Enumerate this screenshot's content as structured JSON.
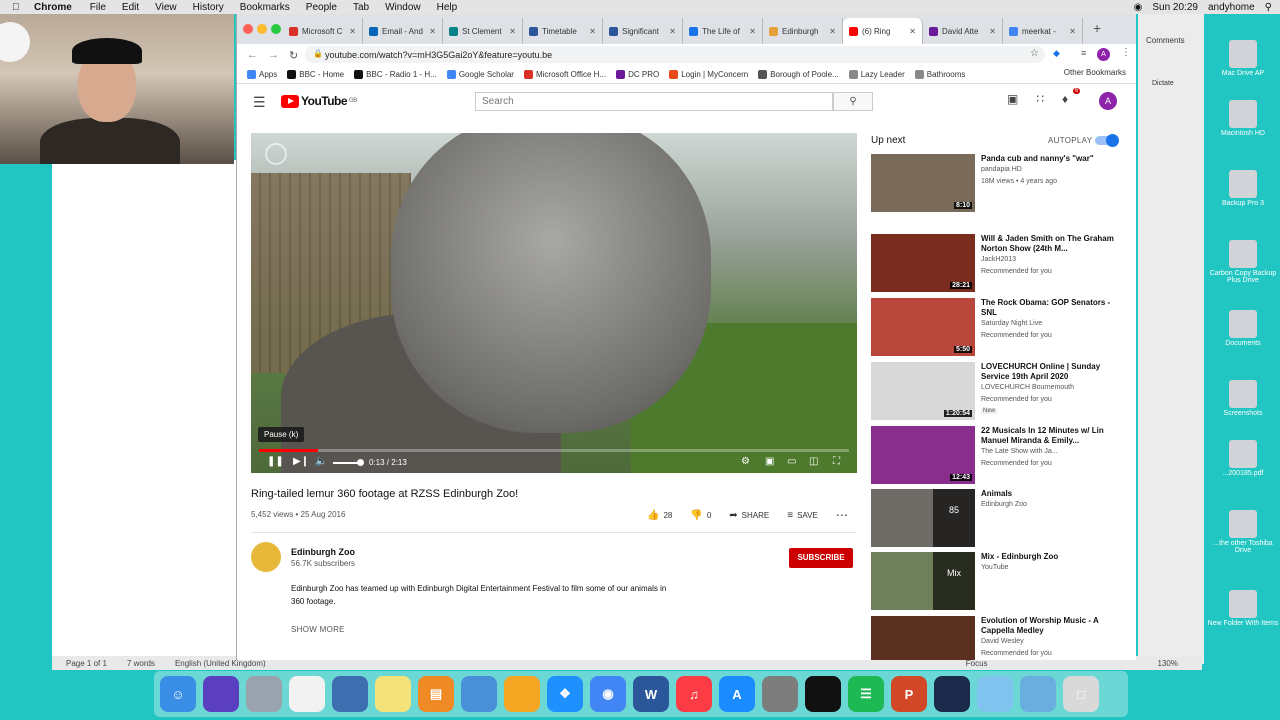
{
  "menubar": {
    "app": "Chrome",
    "items": [
      "File",
      "Edit",
      "View",
      "History",
      "Bookmarks",
      "People",
      "Tab",
      "Window",
      "Help"
    ],
    "clock": "Sun 20:29",
    "user": "andyhome"
  },
  "word": {
    "status": [
      "Page 1 of 1",
      "7 words",
      "English (United Kingdom)"
    ],
    "zoom": "130%",
    "comments": "Comments",
    "dictate": "Dictate",
    "focus": "Focus"
  },
  "tabs": [
    {
      "label": "Microsoft C",
      "color": "#d93025"
    },
    {
      "label": "Email - And",
      "color": "#0364b8"
    },
    {
      "label": "St Clement",
      "color": "#038387"
    },
    {
      "label": "Timetable",
      "color": "#2b579a"
    },
    {
      "label": "Significant",
      "color": "#2b579a"
    },
    {
      "label": "The Life of",
      "color": "#1a73e8"
    },
    {
      "label": "Edinburgh",
      "color": "#e6a13a"
    },
    {
      "label": "(6) Ring",
      "color": "#ff0000",
      "active": true
    },
    {
      "label": "David Atte",
      "color": "#6a1b9a"
    },
    {
      "label": "meerkat -",
      "color": "#4285f4"
    }
  ],
  "address": {
    "url": "youtube.com/watch?v=mH3G5Gai2oY&feature=youtu.be"
  },
  "bookmarks": [
    {
      "label": "Apps",
      "color": "#4285f4"
    },
    {
      "label": "BBC - Home",
      "color": "#111"
    },
    {
      "label": "BBC - Radio 1 - H...",
      "color": "#111"
    },
    {
      "label": "Google Scholar",
      "color": "#4285f4"
    },
    {
      "label": "Microsoft Office H...",
      "color": "#d93025"
    },
    {
      "label": "DC PRO",
      "color": "#6a1b9a"
    },
    {
      "label": "Login | MyConcern",
      "color": "#e64a19"
    },
    {
      "label": "Borough of Poole...",
      "color": "#555"
    },
    {
      "label": "Lazy Leader",
      "color": "#888"
    },
    {
      "label": "Bathrooms",
      "color": "#888"
    }
  ],
  "other_bookmarks": "Other Bookmarks",
  "yt": {
    "logo": "YouTube",
    "region": "GB",
    "search_placeholder": "Search",
    "notif_count": "6",
    "avatar": "A",
    "tooltip": "Pause (k)",
    "time": "0:13 / 2:13",
    "progress": 0.1,
    "title": "Ring-tailed lemur 360 footage at RZSS Edinburgh Zoo!",
    "meta": "5,452 views • 25 Aug 2016",
    "likes": "28",
    "dislikes": "0",
    "share": "SHARE",
    "save": "SAVE",
    "channel": "Edinburgh Zoo",
    "subs": "56.7K subscribers",
    "subscribe": "SUBSCRIBE",
    "description": "Edinburgh Zoo has teamed up with Edinburgh Digital Entertainment Festival to film some of our animals in 360 footage.",
    "show_more": "SHOW MORE",
    "up_next": "Up next",
    "autoplay": "AUTOPLAY"
  },
  "recs": [
    {
      "title": "Panda cub and nanny's \"war\"",
      "channel": "pandapia HD",
      "views": "18M views • 4 years ago",
      "dur": "8:10",
      "bg": "#7a6a5a"
    },
    {
      "title": "Will & Jaden Smith on The Graham Norton Show (24th M...",
      "channel": "JackH2013",
      "views": "Recommended for you",
      "dur": "28:21",
      "bg": "#7a2d1f"
    },
    {
      "title": "The Rock Obama: GOP Senators - SNL",
      "channel": "Saturday Night Live",
      "views": "Recommended for you",
      "dur": "5:50",
      "bg": "#b8463a"
    },
    {
      "title": "LOVECHURCH Online | Sunday Service 19th April 2020",
      "channel": "LOVECHURCH Bournemouth",
      "views": "Recommended for you",
      "dur": "1:20:54",
      "bg": "#d8d8d8",
      "badge": "New"
    },
    {
      "title": "22 Musicals In 12 Minutes w/ Lin Manuel Miranda & Emily...",
      "channel": "The Late Show with Ja...",
      "views": "Recommended for you",
      "dur": "12:43",
      "bg": "#8a2e8e"
    },
    {
      "title": "Animals",
      "channel": "Edinburgh Zoo",
      "views": "",
      "dur": "",
      "bg": "#6f6b66",
      "overlay": "85"
    },
    {
      "title": "Mix - Edinburgh Zoo",
      "channel": "YouTube",
      "views": "",
      "dur": "",
      "bg": "#6f7f5a",
      "overlay": "Mix"
    },
    {
      "title": "Evolution of Worship Music - A Cappella Medley",
      "channel": "David Wesley",
      "views": "Recommended for you",
      "dur": "",
      "bg": "#5a3020"
    }
  ],
  "dock": [
    "Finder",
    "Siri",
    "Launchpad",
    "Reminders",
    "Python",
    "Notes",
    "Books",
    "Preview",
    "Photos",
    "Safari",
    "Chrome",
    "Word",
    "Music",
    "App Store",
    "System Preferences",
    "Klokki",
    "Spotify",
    "PowerPoint",
    "QuickTime",
    "Downloads",
    "Folder",
    "Trash"
  ],
  "desktop": [
    "Mac Drive AP",
    "Macintosh HD",
    "Backup Pro 3",
    "Carbon Copy Backup Plus Drive",
    "Documents",
    "Screenshots",
    "...200185.pdf",
    "...the other Toshiba Drive",
    "New Folder With Items"
  ]
}
